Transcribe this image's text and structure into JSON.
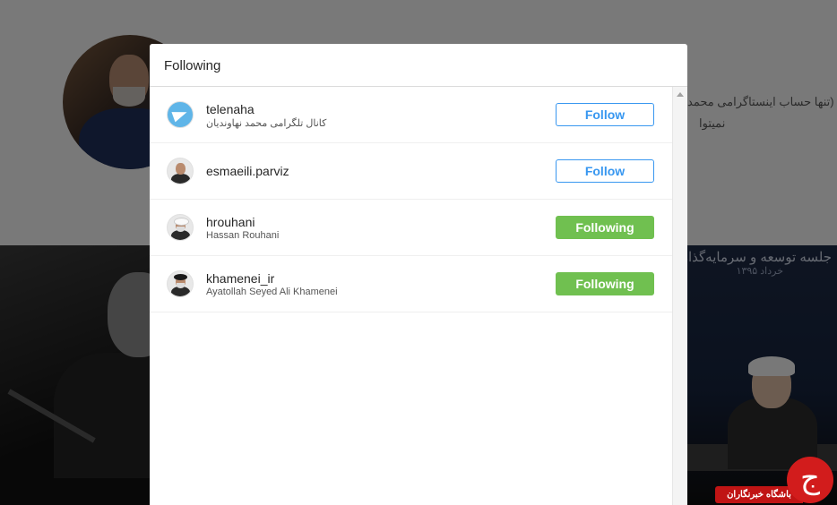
{
  "modal": {
    "title": "Following"
  },
  "following": [
    {
      "username": "telenaha",
      "full_name": "کانال تلگرامی محمد نهاوندیان",
      "button": "Follow",
      "state": "follow",
      "avatar": "telegram-icon"
    },
    {
      "username": "esmaeili.parviz",
      "full_name": "",
      "button": "Follow",
      "state": "follow",
      "avatar": "person-avatar"
    },
    {
      "username": "hrouhani",
      "full_name": "Hassan Rouhani",
      "button": "Following",
      "state": "following",
      "avatar": "person-avatar"
    },
    {
      "username": "khamenei_ir",
      "full_name": "Ayatollah Seyed Ali Khamenei",
      "button": "Following",
      "state": "following",
      "avatar": "person-avatar"
    }
  ],
  "background": {
    "bio_line1": "(تنها حساب اینستاگرامی محمد",
    "bio_line2": "نمیتوا",
    "right_banner": "جلسه توسعه و سرمایه‌گذاری",
    "right_banner_sub": "خرداد ۱۳۹۵"
  },
  "watermark": {
    "text": "باشگاه خبرنگاران",
    "logo_glyph": "ج"
  },
  "colors": {
    "follow_blue": "#3897f0",
    "following_green": "#70c050"
  }
}
